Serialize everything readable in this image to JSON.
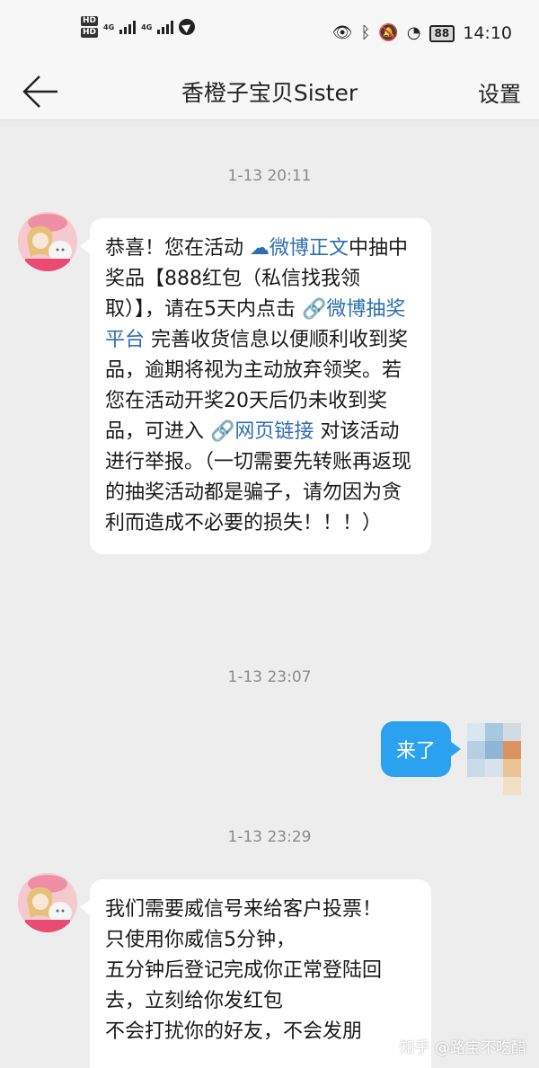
{
  "status_bar": {
    "hd_1": "HD",
    "hd_2": "HD",
    "net_1": "4G",
    "net_2": "4G",
    "battery": "88",
    "time": "14:10"
  },
  "header": {
    "title": "香橙子宝贝Sister",
    "settings_label": "设置"
  },
  "messages": [
    {
      "timestamp": "1-13 20:11",
      "direction": "incoming",
      "segments": [
        {
          "type": "text",
          "text": "恭喜！您在活动 "
        },
        {
          "type": "link",
          "icon": "cloud-icon",
          "text": "微博正文"
        },
        {
          "type": "text",
          "text": "中抽中奖品【888红包（私信找我领取）】，请在5天内点击 "
        },
        {
          "type": "link",
          "icon": "link-icon",
          "text": "微博抽奖平台"
        },
        {
          "type": "text",
          "text": " 完善收货信息以便顺利收到奖品，逾期将视为主动放弃领奖。若您在活动开奖20天后仍未收到奖品，可进入 "
        },
        {
          "type": "link",
          "icon": "link-icon",
          "text": "网页链接"
        },
        {
          "type": "text",
          "text": " 对该活动进行举报。（一切需要先转账再返现的抽奖活动都是骗子，请勿因为贪利而造成不必要的损失！！！）"
        }
      ]
    },
    {
      "timestamp": "1-13 23:07",
      "direction": "outgoing",
      "text": "来了"
    },
    {
      "timestamp": "1-13 23:29",
      "direction": "incoming",
      "lines": [
        "我们需要威信号来给客户投票！          只使用你威信5分钟，",
        "五分钟后登记完成你正常登陆回去，立刻给你发红包",
        "不会打扰你的好友，不会发朋"
      ]
    }
  ],
  "watermark": "知乎 @路宝不吃醋"
}
